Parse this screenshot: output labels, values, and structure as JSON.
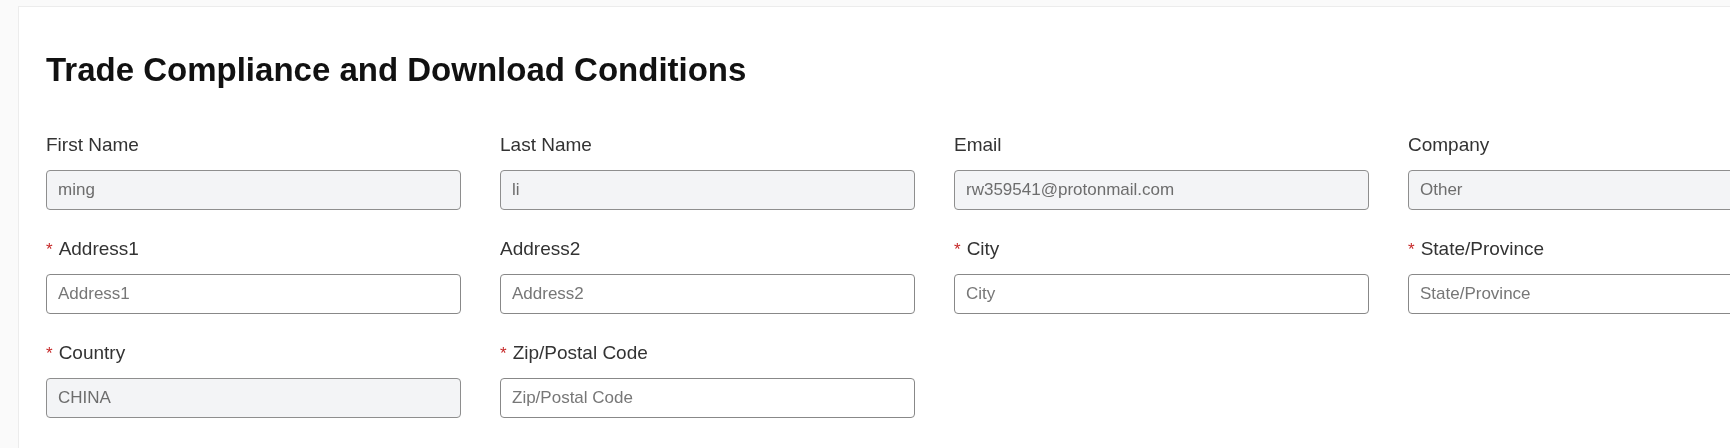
{
  "title": "Trade Compliance and Download Conditions",
  "fields": [
    {
      "label": "First Name",
      "required": false,
      "value": "ming",
      "disabled": true
    },
    {
      "label": "Last Name",
      "required": false,
      "value": "li",
      "disabled": true
    },
    {
      "label": "Email",
      "required": false,
      "value": "rw359541@protonmail.com",
      "disabled": true
    },
    {
      "label": "Company",
      "required": false,
      "value": "Other",
      "disabled": true
    },
    {
      "label": "Address1",
      "required": true,
      "placeholder": "Address1",
      "disabled": false
    },
    {
      "label": "Address2",
      "required": false,
      "placeholder": "Address2",
      "disabled": false
    },
    {
      "label": "City",
      "required": true,
      "placeholder": "City",
      "disabled": false
    },
    {
      "label": "State/Province",
      "required": true,
      "placeholder": "State/Province",
      "disabled": false
    },
    {
      "label": "Country",
      "required": true,
      "value": "CHINA",
      "disabled": true
    },
    {
      "label": "Zip/Postal Code",
      "required": true,
      "placeholder": "Zip/Postal Code",
      "disabled": false
    }
  ],
  "required_mark": "*"
}
